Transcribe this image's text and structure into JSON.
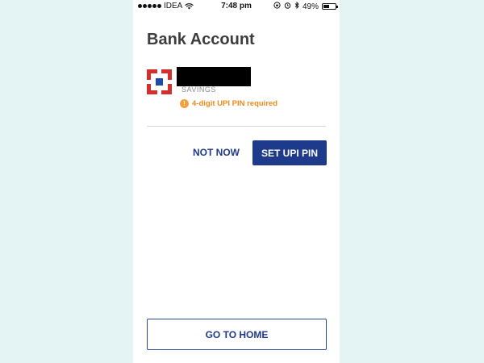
{
  "status_bar": {
    "carrier": "IDEA",
    "time": "7:48 pm",
    "battery": "49%",
    "battery_level": 0.49
  },
  "page": {
    "title": "Bank Account"
  },
  "account": {
    "type": "SAVINGS",
    "warning": "4-digit UPI PIN required",
    "brand_colors": {
      "primary": "#d32f2f",
      "accent": "#1e4aa8"
    }
  },
  "actions": {
    "not_now_label": "NOT NOW",
    "set_pin_label": "SET UPI PIN",
    "go_home_label": "GO TO HOME"
  },
  "icons": {
    "signal": "signal-dots-icon",
    "wifi": "wifi-icon",
    "alarm": "alarm-icon",
    "bluetooth": "bluetooth-icon",
    "rotation_lock": "rotation-lock-icon",
    "battery": "battery-icon",
    "warning": "exclamation-icon"
  },
  "colors": {
    "primary_button": "#1e3a8a",
    "warning": "#f08a1c",
    "background": "#e4f3f4"
  }
}
